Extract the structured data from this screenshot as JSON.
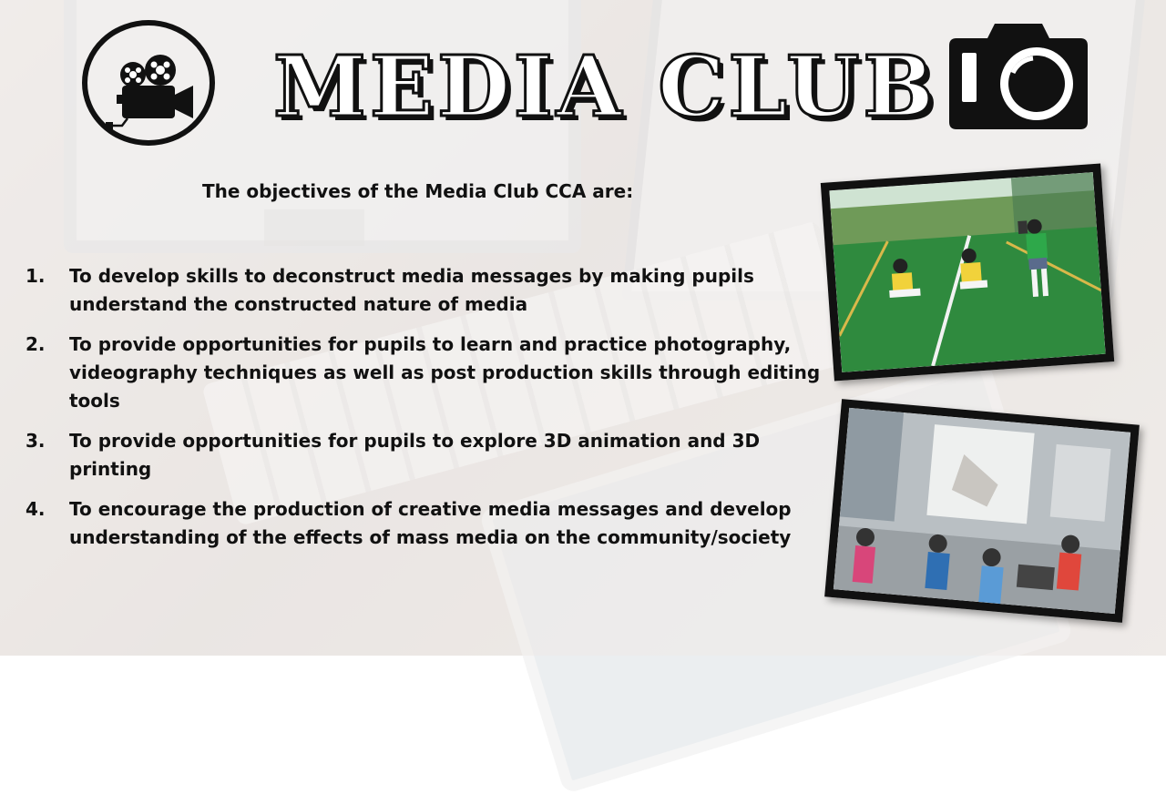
{
  "title": "MEDIA CLUB",
  "subtitle": "The objectives of the Media Club CCA are:",
  "objectives": [
    {
      "num": "1.",
      "text": "To develop skills to deconstruct media messages by making pupils understand the constructed nature of media"
    },
    {
      "num": "2.",
      "text": "To provide opportunities for pupils to learn and practice photography, videography techniques as well as post production skills through editing tools"
    },
    {
      "num": "3.",
      "text": "To provide opportunities for pupils to explore 3D animation and 3D printing"
    },
    {
      "num": "4.",
      "text": "To encourage the production of creative media messages and develop understanding of the effects of mass media on the community/society"
    }
  ],
  "icons": {
    "left": "film-camera-icon",
    "right": "photo-camera-icon"
  },
  "colors": {
    "text": "#111111",
    "frame": "#111111"
  }
}
